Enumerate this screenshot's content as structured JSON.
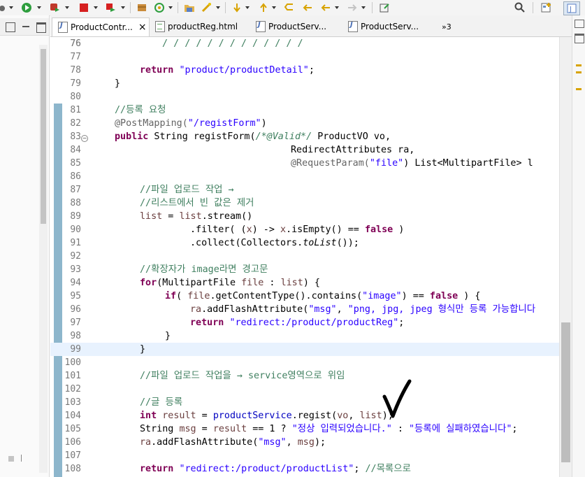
{
  "tabs": [
    {
      "label": "ProductContr...",
      "type": "java",
      "active": true,
      "close": "×"
    },
    {
      "label": "productReg.html",
      "type": "html",
      "active": false
    },
    {
      "label": "ProductServ...",
      "type": "java",
      "active": false
    },
    {
      "label": "ProductServ...",
      "type": "java",
      "active": false
    },
    {
      "label": "»3",
      "type": "overflow",
      "active": false
    }
  ],
  "code": {
    "lines": [
      {
        "n": "76"
      },
      {
        "n": "77"
      },
      {
        "n": "78"
      },
      {
        "n": "79"
      },
      {
        "n": "80"
      },
      {
        "n": "81"
      },
      {
        "n": "82"
      },
      {
        "n": "83"
      },
      {
        "n": "84"
      },
      {
        "n": "85"
      },
      {
        "n": "86"
      },
      {
        "n": "87"
      },
      {
        "n": "88"
      },
      {
        "n": "89"
      },
      {
        "n": "90"
      },
      {
        "n": "91"
      },
      {
        "n": "92"
      },
      {
        "n": "93"
      },
      {
        "n": "94"
      },
      {
        "n": "95"
      },
      {
        "n": "96"
      },
      {
        "n": "97"
      },
      {
        "n": "98"
      },
      {
        "n": "99"
      },
      {
        "n": "100"
      },
      {
        "n": "101"
      },
      {
        "n": "102"
      },
      {
        "n": "103"
      },
      {
        "n": "104"
      },
      {
        "n": "105"
      },
      {
        "n": "106"
      },
      {
        "n": "107"
      },
      {
        "n": "108"
      }
    ],
    "t": {
      "l78_kw": "return",
      "l78_str": "\"product/productDetail\"",
      "l78_end": ";",
      "l79": "}",
      "l81": "//등록 요청",
      "l82_ann": "@PostMapping(",
      "l82_str": "\"/registForm\"",
      "l82_end": ")",
      "l83_kw": "public",
      "l83_a": " String registForm(",
      "l83_com": "/*@Valid*/",
      "l83_b": " ProductVO vo,",
      "l84": "RedirectAttributes ra,",
      "l85_ann": "@RequestParam(",
      "l85_str": "\"file\"",
      "l85_b": ") List<MultipartFile> l",
      "l87": "//파일 업로드 작업 →",
      "l88": "//리스트에서 빈 값은 제거",
      "l89_a": "list",
      "l89_b": " = ",
      "l89_c": "list",
      "l89_d": ".stream()",
      "l90_a": ".filter( (",
      "l90_b": "x",
      "l90_c": ") -> ",
      "l90_d": "x",
      "l90_e": ".isEmpty() == ",
      "l90_kw": "false",
      "l90_f": " )",
      "l91_a": ".collect(Collectors.",
      "l91_b": "toList",
      "l91_c": "());",
      "l93": "//확장자가 image라면 경고문",
      "l94_kw": "for",
      "l94_a": "(MultipartFile ",
      "l94_b": "file",
      "l94_c": " : ",
      "l94_d": "list",
      "l94_e": ") {",
      "l95_kw": "if",
      "l95_a": "( ",
      "l95_b": "file",
      "l95_c": ".getContentType().contains(",
      "l95_str": "\"image\"",
      "l95_d": ") == ",
      "l95_kw2": "false",
      "l95_e": " ) {",
      "l96_a": "ra",
      "l96_b": ".addFlashAttribute(",
      "l96_s1": "\"msg\"",
      "l96_c": ", ",
      "l96_s2": "\"png, jpg, jpeg 형식만 등록 가능합니다",
      "l97_kw": "return",
      "l97_str": "\"redirect:/product/productReg\"",
      "l97_end": ";",
      "l98": "}",
      "l99": "}",
      "l101": "//파일 업로드 작업을 → service영역으로 위임",
      "l103": "//글 등록",
      "l104_kw": "int",
      "l104_a": "result",
      "l104_b": " = ",
      "l104_c": "productService",
      "l104_d": ".regist(",
      "l104_e": "vo",
      "l104_f": ", ",
      "l104_g": "list",
      "l104_h": ");",
      "l105_a": "String ",
      "l105_b": "msg",
      "l105_c": " = ",
      "l105_d": "result",
      "l105_e": " == 1 ? ",
      "l105_s1": "\"정상 입력되었습니다.\"",
      "l105_f": " : ",
      "l105_s2": "\"등록에 실패하였습니다\"",
      "l105_g": ";",
      "l106_a": "ra",
      "l106_b": ".addFlashAttribute(",
      "l106_s": "\"msg\"",
      "l106_c": ", ",
      "l106_d": "msg",
      "l106_e": ");",
      "l108_kw": "return",
      "l108_str": "\"redirect:/product/productList\"",
      "l108_end": ";",
      "l108_com": " //목록으로"
    }
  },
  "icons": [
    "bug-icon",
    "run-icon",
    "coverage-icon",
    "stop-icon",
    "debug-server-icon",
    "package-icon",
    "refresh-icon",
    "open-folder-icon",
    "magic-wand-icon",
    "next-annotation-icon",
    "prev-annotation-icon",
    "last-edit-icon",
    "back-icon",
    "forward-icon",
    "pin-icon",
    "search-icon",
    "perspective-icon",
    "java-perspective-icon"
  ],
  "colors": {
    "keyword": "#7f0055",
    "string": "#2a00ff",
    "comment": "#3f7f5f",
    "current_line": "#e8f2fe",
    "change_bar": "#8db6cc"
  }
}
